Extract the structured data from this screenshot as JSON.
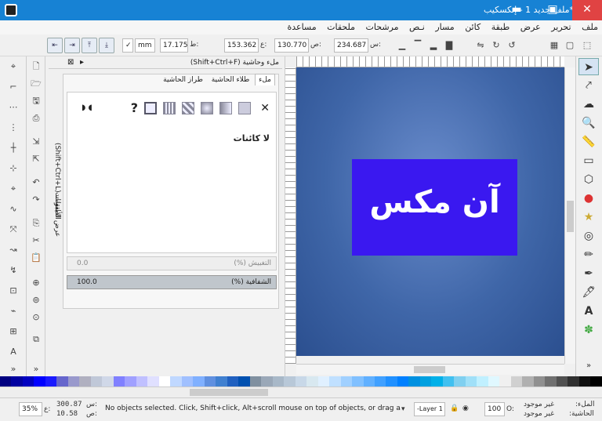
{
  "window": {
    "title": "ملف جديد 1 - إنكسكيب*",
    "minimize": "▬",
    "maximize": "▣",
    "close": "✕"
  },
  "menu": [
    "ملف",
    "تحرير",
    "عرض",
    "طبقة",
    "كائن",
    "مسار",
    "نـص",
    "مرشحات",
    "ملحقات",
    "مساعدة"
  ],
  "toolbar": {
    "x_label": "س:",
    "x_value": "234.687",
    "y_label": "ص:",
    "y_value": "130.770",
    "w_label": "ع:",
    "w_value": "153.362",
    "h_label": "ط:",
    "h_value": "17.175",
    "unit": "mm"
  },
  "dock": {
    "tab_fill_stroke": "ملء وحاشية (Shift+Ctrl+F)",
    "side_tab_1": "الطبقات (Shift+Ctrl+L)",
    "side_tab_2": "عرض الأيقونات",
    "subtabs": [
      "ملء",
      "طلاء الحاشية",
      "طراز الحاشية"
    ],
    "no_objects": "لا كائنات",
    "blur_label": "التغبيش (%)",
    "blur_value": "0.0",
    "opacity_label": "الشفافية (%)",
    "opacity_value": "100.0"
  },
  "canvas": {
    "text": "آن مكس",
    "rect_color": "#3a18f0",
    "bg_color": "#3f66a8"
  },
  "status": {
    "fill_label": "الملء:",
    "fill_value": "غير موجود",
    "stroke_label": "الحاشية:",
    "stroke_value": "غير موجود",
    "opacity_o": "O:",
    "opacity": "100",
    "layer": "-Layer 1",
    "message": "No objects selected. Click, Shift+click, Alt+scroll mouse on top of objects, or drag a...",
    "x_label": "س:",
    "x": "300.87",
    "y_label": "ص:",
    "y": "10.58",
    "z_label": "ع:",
    "zoom": "35%"
  },
  "palette": [
    "#000080",
    "#0000a0",
    "#0000c0",
    "#0000ff",
    "#1a1aff",
    "#6666cc",
    "#9999cc",
    "#b0b0c0",
    "#c0c8d8",
    "#d0d8e8",
    "#8080ff",
    "#a0a0ff",
    "#c0c0ff",
    "#e0e0ff",
    "#ffffff",
    "#c0d8ff",
    "#a0c0ff",
    "#80b0ff",
    "#6090e0",
    "#4080d0",
    "#2060c0",
    "#0050b0",
    "#8090a0",
    "#9aa8b8",
    "#a8b8c8",
    "#b8c8d8",
    "#c8d8e8",
    "#d8e8f0",
    "#e0f0ff",
    "#c0e0ff",
    "#a0d0ff",
    "#80c0ff",
    "#60b0ff",
    "#40a0ff",
    "#2090ff",
    "#0080ff",
    "#0090e0",
    "#00a0e0",
    "#00b0e8",
    "#40c0f0",
    "#80d0f0",
    "#a0e0f8",
    "#c0f0ff",
    "#e0f8ff",
    "#f0f0f0",
    "#d0d0d0",
    "#b0b0b0",
    "#909090",
    "#707070",
    "#505050",
    "#303030",
    "#101010",
    "#000000"
  ]
}
